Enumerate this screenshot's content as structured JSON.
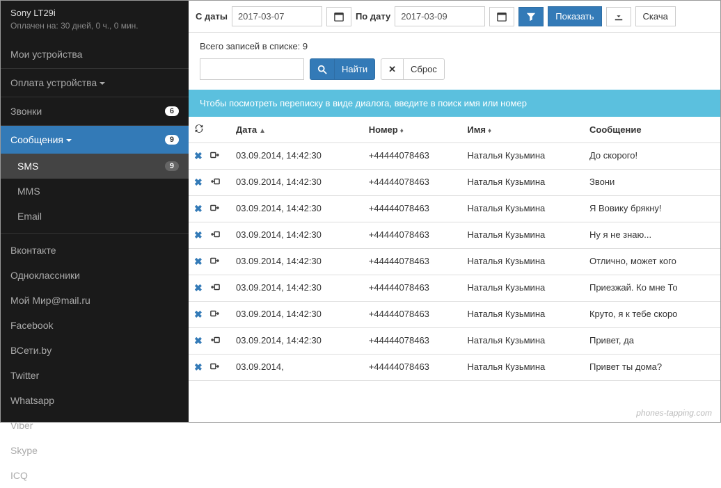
{
  "sidebar": {
    "device": "Sony LT29i",
    "paid_status": "Оплачен на: 30 дней, 0 ч., 0 мин.",
    "my_devices": "Мои устройства",
    "device_payment": "Оплата устройства",
    "calls": {
      "label": "Звонки",
      "badge": "6"
    },
    "messages": {
      "label": "Сообщения",
      "badge": "9"
    },
    "msg_sub": {
      "sms": {
        "label": "SMS",
        "badge": "9"
      },
      "mms": "MMS",
      "email": "Email"
    },
    "social": [
      "Вконтакте",
      "Одноклассники",
      "Мой Мир@mail.ru",
      "Facebook",
      "ВСети.by",
      "Twitter",
      "Whatsapp",
      "Viber",
      "Skype",
      "ICQ"
    ]
  },
  "toolbar": {
    "from_label": "С даты",
    "from_value": "2017-03-07",
    "to_label": "По дату",
    "to_value": "2017-03-09",
    "show": "Показать",
    "download": "Скача"
  },
  "list_header": "Всего записей в списке: 9",
  "search": {
    "find": "Найти",
    "reset": "Сброс"
  },
  "info": "Чтобы посмотреть переписку в виде диалога, введите в поиск имя или номер",
  "columns": {
    "date": "Дата",
    "number": "Номер",
    "name": "Имя",
    "message": "Сообщение"
  },
  "rows": [
    {
      "dir": "out",
      "date": "03.09.2014, 14:42:30",
      "number": "+44444078463",
      "name": "Наталья Кузьмина",
      "msg": "До скорого!"
    },
    {
      "dir": "in",
      "date": "03.09.2014, 14:42:30",
      "number": "+44444078463",
      "name": "Наталья Кузьмина",
      "msg": "Звони"
    },
    {
      "dir": "out",
      "date": "03.09.2014, 14:42:30",
      "number": "+44444078463",
      "name": "Наталья Кузьмина",
      "msg": "Я Вовику брякну!"
    },
    {
      "dir": "in",
      "date": "03.09.2014, 14:42:30",
      "number": "+44444078463",
      "name": "Наталья Кузьмина",
      "msg": "Ну я не знаю..."
    },
    {
      "dir": "out",
      "date": "03.09.2014, 14:42:30",
      "number": "+44444078463",
      "name": "Наталья Кузьмина",
      "msg": "Отлично, может кого"
    },
    {
      "dir": "in",
      "date": "03.09.2014, 14:42:30",
      "number": "+44444078463",
      "name": "Наталья Кузьмина",
      "msg": "Приезжай. Ко мне То"
    },
    {
      "dir": "out",
      "date": "03.09.2014, 14:42:30",
      "number": "+44444078463",
      "name": "Наталья Кузьмина",
      "msg": "Круто, я к тебе скоро"
    },
    {
      "dir": "in",
      "date": "03.09.2014, 14:42:30",
      "number": "+44444078463",
      "name": "Наталья Кузьмина",
      "msg": "Привет, да"
    },
    {
      "dir": "out",
      "date": "03.09.2014,",
      "number": "+44444078463",
      "name": "Наталья Кузьмина",
      "msg": "Привет ты дома?"
    }
  ],
  "watermark": "phones-tapping.com"
}
